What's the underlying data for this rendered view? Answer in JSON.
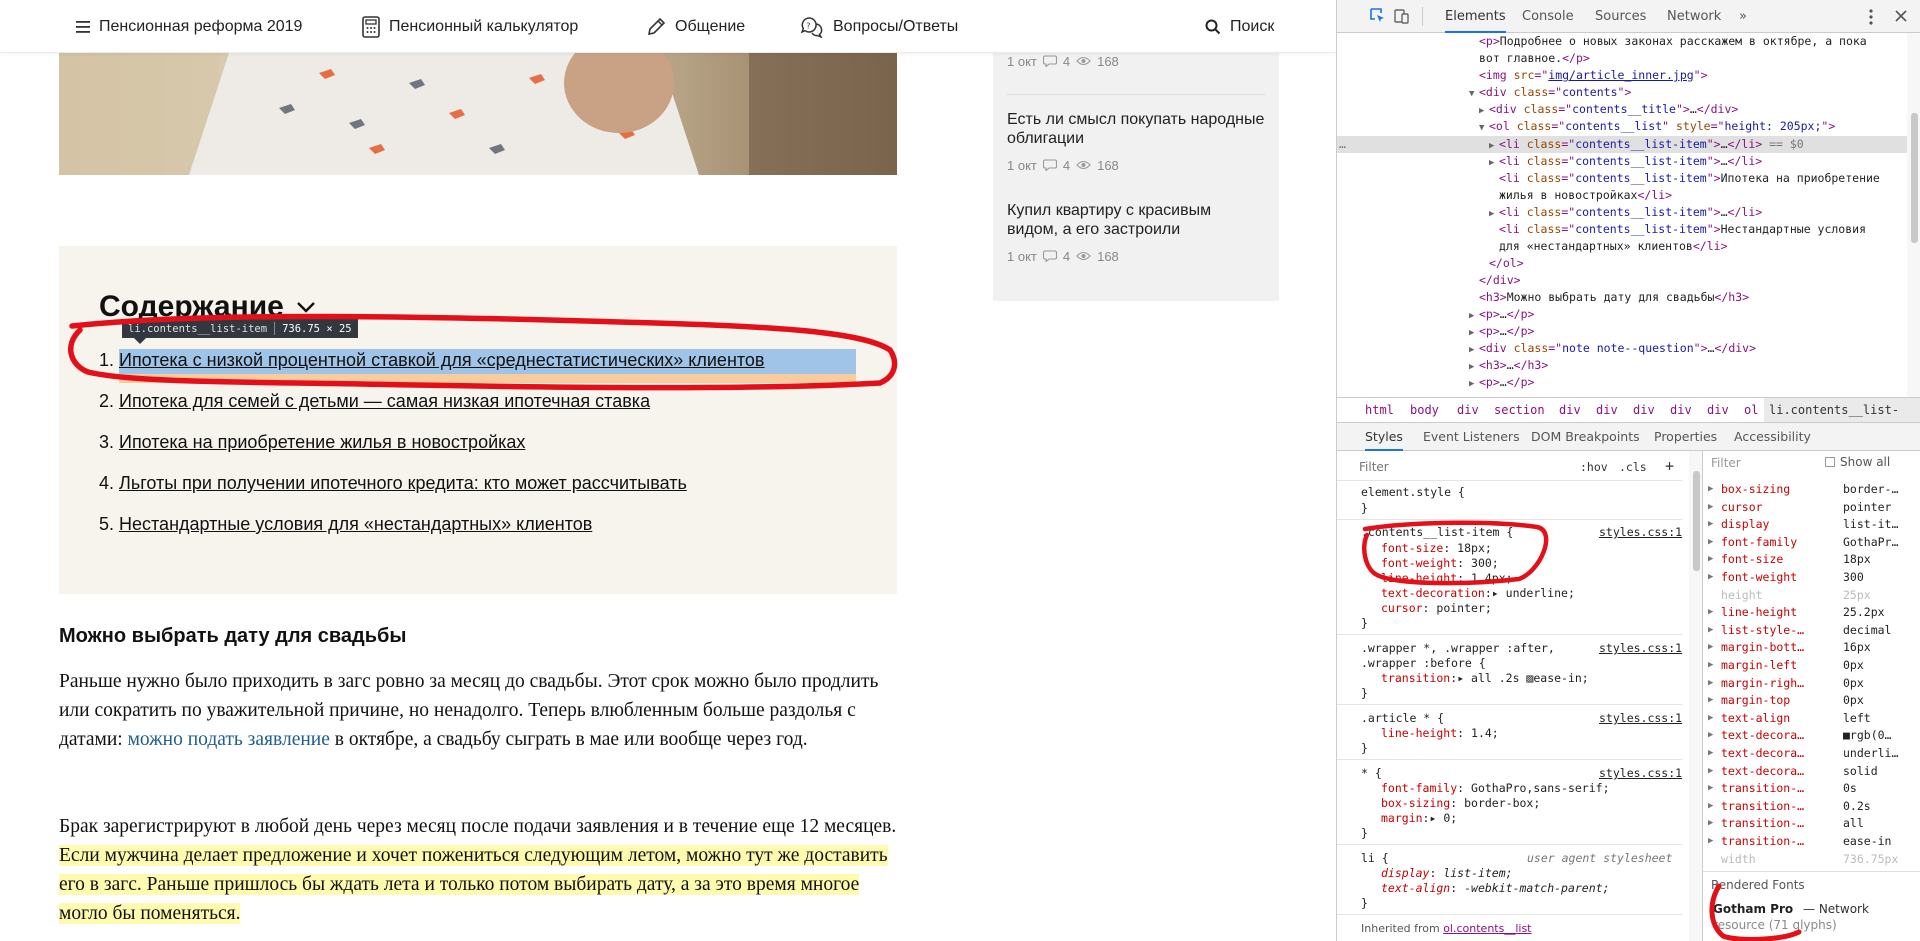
{
  "site": {
    "nav": [
      {
        "label": "Пенсионная реформа 2019",
        "icon": "hamburger-icon"
      },
      {
        "label": "Пенсионный калькулятор",
        "icon": "calculator-icon"
      },
      {
        "label": "Общение",
        "icon": "pencil-icon"
      },
      {
        "label": "Вопросы/Ответы",
        "icon": "question-bubble-icon"
      }
    ],
    "search_label": "Поиск",
    "sidebar": {
      "items": [
        {
          "title": "",
          "date": "1 окт",
          "comments": "4",
          "views": "168"
        },
        {
          "title": "Есть ли смысл покупать народные облигации",
          "date": "1 окт",
          "comments": "4",
          "views": "168"
        },
        {
          "title": "Купил квартиру с красивым видом, а его застроили",
          "date": "1 окт",
          "comments": "4",
          "views": "168"
        }
      ]
    },
    "toc": {
      "title": "Содержание",
      "items": [
        {
          "num": "1.",
          "text": "Ипотека с низкой процентной ставкой для «среднестатистических» клиентов"
        },
        {
          "num": "2.",
          "text": "Ипотека для семей с детьми — самая низкая ипотечная ставка"
        },
        {
          "num": "3.",
          "text": "Ипотека на приобретение жилья в новостройках"
        },
        {
          "num": "4.",
          "text": "Льготы при получении ипотечного кредита: кто может рассчитывать"
        },
        {
          "num": "5.",
          "text": "Нестандартные условия для «нестандартных» клиентов"
        }
      ],
      "tooltip_selector": "li.contents__list-item",
      "tooltip_size": "736.75 × 25"
    },
    "article": {
      "heading": "Можно выбрать дату для свадьбы",
      "p1_before": "Раньше нужно было приходить в загс ровно за месяц до свадьбы. Этот срок можно было продлить или сократить по уважительной причине, но ненадолго. Теперь влюбленным больше раздолья с датами: ",
      "p1_link": "можно подать заявление",
      "p1_after": " в октябре, а свадьбу сыграть в мае или вообще через год.",
      "p2_before": "Брак зарегистрируют в любой день через месяц после подачи заявления и в течение еще 12 месяцев. ",
      "p2_highlight": "Если мужчина делает предложение и хочет пожениться следующим летом, можно тут же доставить его в загс. Раньше пришлось бы ждать лета и только потом выбирать дату, а за это время многое могло бы поменяться."
    }
  },
  "devtools": {
    "tabs": [
      "Elements",
      "Console",
      "Sources",
      "Network",
      "»"
    ],
    "active_tab": "Elements",
    "breadcrumbs": [
      "html",
      "body",
      "div",
      "section",
      "div",
      "div",
      "div",
      "div",
      "div",
      "ol",
      "li.contents__list-item"
    ],
    "subtabs": [
      "Styles",
      "Event Listeners",
      "DOM Breakpoints",
      "Properties",
      "Accessibility"
    ],
    "filter_placeholder": "Filter",
    "hov_label": ":hov",
    "cls_label": ".cls",
    "add_label": "+",
    "computed_filter": "Filter",
    "show_all": "Show all",
    "computed": [
      {
        "name": "box-sizing",
        "value": "border-…",
        "inherited": false
      },
      {
        "name": "cursor",
        "value": "pointer",
        "inherited": false
      },
      {
        "name": "display",
        "value": "list-it…",
        "inherited": false
      },
      {
        "name": "font-family",
        "value": "GothaPr…",
        "inherited": false
      },
      {
        "name": "font-size",
        "value": "18px",
        "inherited": false
      },
      {
        "name": "font-weight",
        "value": "300",
        "inherited": false
      },
      {
        "name": "height",
        "value": "25px",
        "inherited": true
      },
      {
        "name": "line-height",
        "value": "25.2px",
        "inherited": false
      },
      {
        "name": "list-style-…",
        "value": "decimal",
        "inherited": false
      },
      {
        "name": "margin-bott…",
        "value": "16px",
        "inherited": false
      },
      {
        "name": "margin-left",
        "value": "0px",
        "inherited": false
      },
      {
        "name": "margin-righ…",
        "value": "0px",
        "inherited": false
      },
      {
        "name": "margin-top",
        "value": "0px",
        "inherited": false
      },
      {
        "name": "text-align",
        "value": "left",
        "inherited": false
      },
      {
        "name": "text-decora…",
        "value": "■rgb(0…",
        "inherited": false
      },
      {
        "name": "text-decora…",
        "value": "underli…",
        "inherited": false
      },
      {
        "name": "text-decora…",
        "value": "solid",
        "inherited": false
      },
      {
        "name": "transition-…",
        "value": "0s",
        "inherited": false
      },
      {
        "name": "transition-…",
        "value": "0.2s",
        "inherited": false
      },
      {
        "name": "transition-…",
        "value": "all",
        "inherited": false
      },
      {
        "name": "transition-…",
        "value": "ease-in",
        "inherited": false
      },
      {
        "name": "width",
        "value": "736.75px",
        "inherited": true
      }
    ],
    "rendered_fonts_label": "Rendered Fonts",
    "font_name": "Gotham Pro",
    "font_source": "— Network",
    "font_glyphs": "resource (71 glyphs)",
    "inherited_from": "Inherited from",
    "inherited_selector": "ol.contents__list"
  },
  "colors": {
    "accent_blue": "#1a73e8",
    "annotation_red": "#e3101a",
    "toc_bg": "#f6f4ec",
    "link": "#1f5e8a",
    "highlight": "#fefbb0"
  }
}
